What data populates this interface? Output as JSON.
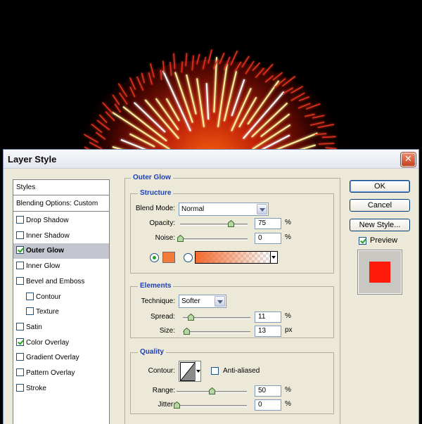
{
  "window": {
    "title": "Layer Style",
    "close_label": "✕"
  },
  "styles_list": {
    "header": "Styles",
    "blending": "Blending Options: Custom",
    "items": [
      {
        "label": "Drop Shadow",
        "checked": false,
        "selected": false,
        "indent": false
      },
      {
        "label": "Inner Shadow",
        "checked": false,
        "selected": false,
        "indent": false
      },
      {
        "label": "Outer Glow",
        "checked": true,
        "selected": true,
        "indent": false
      },
      {
        "label": "Inner Glow",
        "checked": false,
        "selected": false,
        "indent": false
      },
      {
        "label": "Bevel and Emboss",
        "checked": false,
        "selected": false,
        "indent": false
      },
      {
        "label": "Contour",
        "checked": false,
        "selected": false,
        "indent": true
      },
      {
        "label": "Texture",
        "checked": false,
        "selected": false,
        "indent": true
      },
      {
        "label": "Satin",
        "checked": false,
        "selected": false,
        "indent": false
      },
      {
        "label": "Color Overlay",
        "checked": true,
        "selected": false,
        "indent": false
      },
      {
        "label": "Gradient Overlay",
        "checked": false,
        "selected": false,
        "indent": false
      },
      {
        "label": "Pattern Overlay",
        "checked": false,
        "selected": false,
        "indent": false
      },
      {
        "label": "Stroke",
        "checked": false,
        "selected": false,
        "indent": false
      }
    ]
  },
  "outer_glow": {
    "title": "Outer Glow",
    "structure": {
      "title": "Structure",
      "blend_mode_label": "Blend Mode:",
      "blend_mode_value": "Normal",
      "opacity_label": "Opacity:",
      "opacity_value": "75",
      "opacity_fraction": 0.75,
      "noise_label": "Noise:",
      "noise_value": "0",
      "noise_fraction": 0,
      "unit_percent": "%",
      "glow_color": "#f47a3a",
      "gradient_start": "#f26a2d"
    },
    "elements": {
      "title": "Elements",
      "technique_label": "Technique:",
      "technique_value": "Softer",
      "spread_label": "Spread:",
      "spread_value": "11",
      "spread_fraction": 0.11,
      "size_label": "Size:",
      "size_value": "13",
      "size_fraction": 0.052,
      "unit_percent": "%",
      "unit_px": "px"
    },
    "quality": {
      "title": "Quality",
      "contour_label": "Contour:",
      "anti_aliased_label": "Anti-aliased",
      "anti_aliased_checked": false,
      "range_label": "Range:",
      "range_value": "50",
      "range_fraction": 0.5,
      "jitter_label": "Jitter:",
      "jitter_value": "0",
      "jitter_fraction": 0,
      "unit_percent": "%"
    }
  },
  "buttons": {
    "ok": "OK",
    "cancel": "Cancel",
    "new_style": "New Style..."
  },
  "preview": {
    "label": "Preview",
    "checked": true,
    "swatch_color": "#ff1a0a"
  }
}
